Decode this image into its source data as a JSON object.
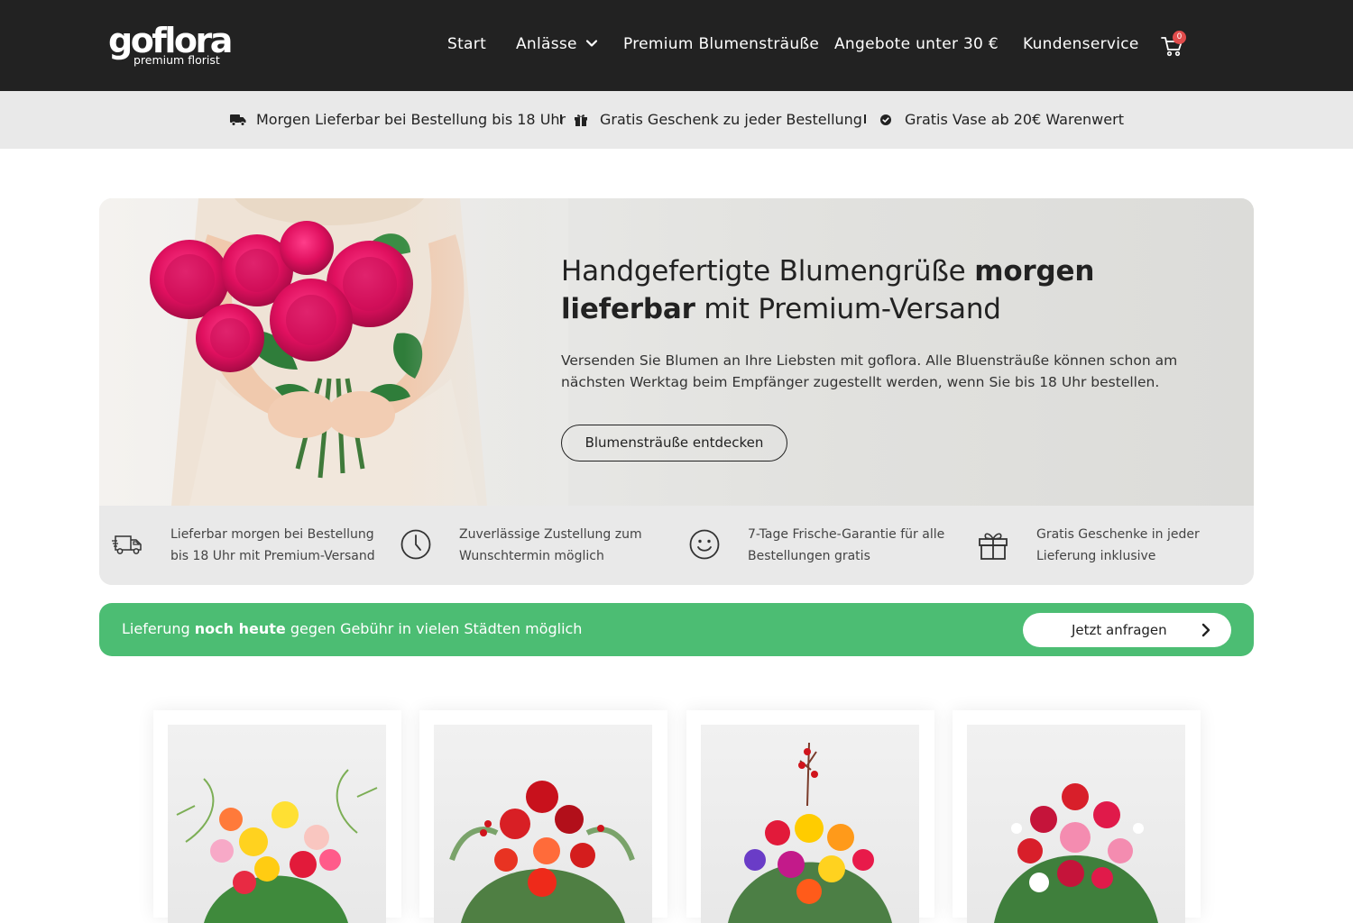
{
  "brand": {
    "name": "goflora",
    "tagline": "premium florist"
  },
  "nav": {
    "items": [
      {
        "label": "Start"
      },
      {
        "label": "Anlässe"
      },
      {
        "label": "Premium Blumensträuße"
      },
      {
        "label": "Angebote unter 30 €"
      },
      {
        "label": "Kundenservice"
      }
    ],
    "cart_count": "0"
  },
  "usp_bar": [
    {
      "icon": "truck-icon",
      "text": "Morgen Lieferbar bei Bestellung bis 18 Uhr"
    },
    {
      "icon": "gift-icon",
      "text": "Gratis Geschenk zu jeder Bestellung"
    },
    {
      "icon": "check-circle-icon",
      "text": "Gratis Vase ab 20€ Warenwert"
    }
  ],
  "hero": {
    "title_part1": "Handgefertigte Blumengrüße ",
    "title_bold": "morgen lieferbar",
    "title_part2": " mit Premium-Versand",
    "text": "Versenden Sie Blumen an Ihre Liebsten mit goflora. Alle Bluensträuße können schon am nächsten Werktag beim Empfänger zugestellt werden, wenn Sie bis 18 Uhr bestellen.",
    "button": "Blumensträuße entdecken"
  },
  "features": [
    {
      "icon": "delivery-truck-icon",
      "text": "Lieferbar morgen bei Bestellung bis 18 Uhr mit Premium-Versand"
    },
    {
      "icon": "clock-icon",
      "text": "Zuverlässige Zustellung zum Wunschtermin möglich"
    },
    {
      "icon": "smiley-icon",
      "text": "7-Tage Frische-Garantie für alle Bestellungen gratis"
    },
    {
      "icon": "gift-box-icon",
      "text": "Gratis Geschenke in jeder Lieferung inklusive"
    }
  ],
  "banner": {
    "text_part1": "Lieferung ",
    "text_bold": "noch heute",
    "text_part2": " gegen Gebühr in vielen Städten möglich",
    "button": "Jetzt anfragen",
    "color": "#4cbd73"
  },
  "colors": {
    "header": "#222222",
    "usp_bar": "#e9e9e9",
    "accent_green": "#4cbd73",
    "badge": "#e14c4c"
  }
}
